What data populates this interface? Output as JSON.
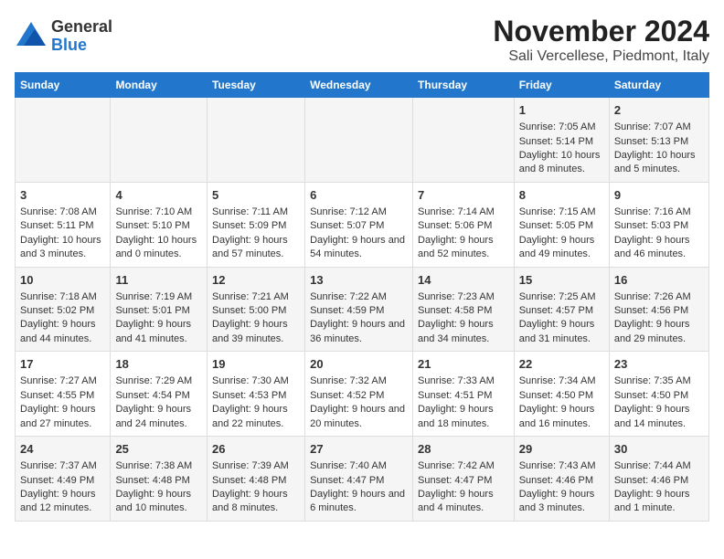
{
  "logo": {
    "general": "General",
    "blue": "Blue"
  },
  "title": "November 2024",
  "subtitle": "Sali Vercellese, Piedmont, Italy",
  "headers": [
    "Sunday",
    "Monday",
    "Tuesday",
    "Wednesday",
    "Thursday",
    "Friday",
    "Saturday"
  ],
  "weeks": [
    [
      {
        "day": "",
        "info": ""
      },
      {
        "day": "",
        "info": ""
      },
      {
        "day": "",
        "info": ""
      },
      {
        "day": "",
        "info": ""
      },
      {
        "day": "",
        "info": ""
      },
      {
        "day": "1",
        "info": "Sunrise: 7:05 AM\nSunset: 5:14 PM\nDaylight: 10 hours and 8 minutes."
      },
      {
        "day": "2",
        "info": "Sunrise: 7:07 AM\nSunset: 5:13 PM\nDaylight: 10 hours and 5 minutes."
      }
    ],
    [
      {
        "day": "3",
        "info": "Sunrise: 7:08 AM\nSunset: 5:11 PM\nDaylight: 10 hours and 3 minutes."
      },
      {
        "day": "4",
        "info": "Sunrise: 7:10 AM\nSunset: 5:10 PM\nDaylight: 10 hours and 0 minutes."
      },
      {
        "day": "5",
        "info": "Sunrise: 7:11 AM\nSunset: 5:09 PM\nDaylight: 9 hours and 57 minutes."
      },
      {
        "day": "6",
        "info": "Sunrise: 7:12 AM\nSunset: 5:07 PM\nDaylight: 9 hours and 54 minutes."
      },
      {
        "day": "7",
        "info": "Sunrise: 7:14 AM\nSunset: 5:06 PM\nDaylight: 9 hours and 52 minutes."
      },
      {
        "day": "8",
        "info": "Sunrise: 7:15 AM\nSunset: 5:05 PM\nDaylight: 9 hours and 49 minutes."
      },
      {
        "day": "9",
        "info": "Sunrise: 7:16 AM\nSunset: 5:03 PM\nDaylight: 9 hours and 46 minutes."
      }
    ],
    [
      {
        "day": "10",
        "info": "Sunrise: 7:18 AM\nSunset: 5:02 PM\nDaylight: 9 hours and 44 minutes."
      },
      {
        "day": "11",
        "info": "Sunrise: 7:19 AM\nSunset: 5:01 PM\nDaylight: 9 hours and 41 minutes."
      },
      {
        "day": "12",
        "info": "Sunrise: 7:21 AM\nSunset: 5:00 PM\nDaylight: 9 hours and 39 minutes."
      },
      {
        "day": "13",
        "info": "Sunrise: 7:22 AM\nSunset: 4:59 PM\nDaylight: 9 hours and 36 minutes."
      },
      {
        "day": "14",
        "info": "Sunrise: 7:23 AM\nSunset: 4:58 PM\nDaylight: 9 hours and 34 minutes."
      },
      {
        "day": "15",
        "info": "Sunrise: 7:25 AM\nSunset: 4:57 PM\nDaylight: 9 hours and 31 minutes."
      },
      {
        "day": "16",
        "info": "Sunrise: 7:26 AM\nSunset: 4:56 PM\nDaylight: 9 hours and 29 minutes."
      }
    ],
    [
      {
        "day": "17",
        "info": "Sunrise: 7:27 AM\nSunset: 4:55 PM\nDaylight: 9 hours and 27 minutes."
      },
      {
        "day": "18",
        "info": "Sunrise: 7:29 AM\nSunset: 4:54 PM\nDaylight: 9 hours and 24 minutes."
      },
      {
        "day": "19",
        "info": "Sunrise: 7:30 AM\nSunset: 4:53 PM\nDaylight: 9 hours and 22 minutes."
      },
      {
        "day": "20",
        "info": "Sunrise: 7:32 AM\nSunset: 4:52 PM\nDaylight: 9 hours and 20 minutes."
      },
      {
        "day": "21",
        "info": "Sunrise: 7:33 AM\nSunset: 4:51 PM\nDaylight: 9 hours and 18 minutes."
      },
      {
        "day": "22",
        "info": "Sunrise: 7:34 AM\nSunset: 4:50 PM\nDaylight: 9 hours and 16 minutes."
      },
      {
        "day": "23",
        "info": "Sunrise: 7:35 AM\nSunset: 4:50 PM\nDaylight: 9 hours and 14 minutes."
      }
    ],
    [
      {
        "day": "24",
        "info": "Sunrise: 7:37 AM\nSunset: 4:49 PM\nDaylight: 9 hours and 12 minutes."
      },
      {
        "day": "25",
        "info": "Sunrise: 7:38 AM\nSunset: 4:48 PM\nDaylight: 9 hours and 10 minutes."
      },
      {
        "day": "26",
        "info": "Sunrise: 7:39 AM\nSunset: 4:48 PM\nDaylight: 9 hours and 8 minutes."
      },
      {
        "day": "27",
        "info": "Sunrise: 7:40 AM\nSunset: 4:47 PM\nDaylight: 9 hours and 6 minutes."
      },
      {
        "day": "28",
        "info": "Sunrise: 7:42 AM\nSunset: 4:47 PM\nDaylight: 9 hours and 4 minutes."
      },
      {
        "day": "29",
        "info": "Sunrise: 7:43 AM\nSunset: 4:46 PM\nDaylight: 9 hours and 3 minutes."
      },
      {
        "day": "30",
        "info": "Sunrise: 7:44 AM\nSunset: 4:46 PM\nDaylight: 9 hours and 1 minute."
      }
    ]
  ]
}
